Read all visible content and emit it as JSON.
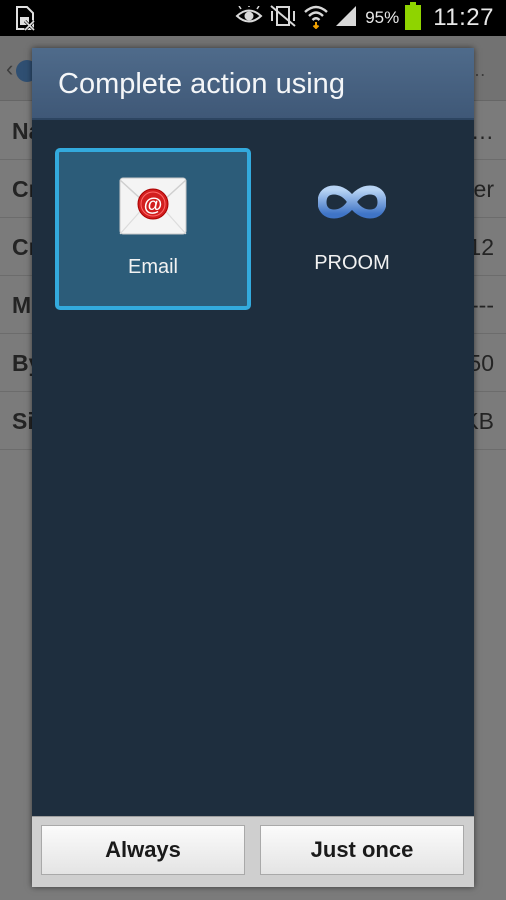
{
  "status_bar": {
    "battery_percent": "95%",
    "time": "11:27",
    "icons": [
      "sim-card-icon",
      "eye-icon",
      "vibrate-mute-icon",
      "wifi-icon",
      "signal-icon",
      "battery-icon"
    ]
  },
  "background_app": {
    "rows": [
      {
        "key": "Na",
        "value": "…"
      },
      {
        "key": "Cr",
        "value": "er"
      },
      {
        "key": "Cr",
        "value": "12"
      },
      {
        "key": "M",
        "value": "---"
      },
      {
        "key": "By",
        "value": "50"
      },
      {
        "key": "Si",
        "value": "KB"
      }
    ]
  },
  "dialog": {
    "title": "Complete action using",
    "apps": [
      {
        "label": "Email",
        "icon": "email-icon",
        "selected": true
      },
      {
        "label": "PROOM",
        "icon": "infinity-icon",
        "selected": false
      }
    ],
    "buttons": {
      "always": "Always",
      "just_once": "Just once"
    }
  },
  "colors": {
    "dialog_background": "#1e2e3e",
    "title_bar": "#4a6585",
    "selection_border": "#33aadd",
    "selection_fill": "#2c5c79",
    "battery": "#8fd400"
  }
}
